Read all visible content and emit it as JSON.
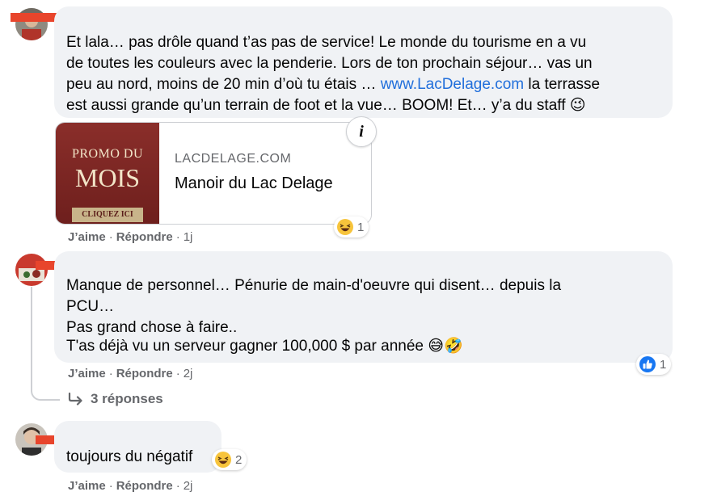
{
  "comments": [
    {
      "lines": [
        "Et lala… pas drôle quand t’as pas de service! Le monde du tourisme en a vu",
        "de toutes les couleurs avec la penderie. Lors de ton prochain séjour… vas un",
        "peu au nord, moins de 20 min d’où tu étais … "
      ],
      "link_text": "www.LacDelage.com",
      "line3_after_link": " la terrasse",
      "line4": "est aussi grande qu’un terrain de foot et la vue… BOOM! Et… y’a du staff 😉",
      "card": {
        "image_line1": "PROMO DU",
        "image_line2": "MOIS",
        "image_ribbon": "CLIQUEZ ICI",
        "domain": "LACDELAGE.COM",
        "title": "Manoir du Lac Delage",
        "info_icon": "i"
      },
      "reaction": {
        "icon": "laughing-emoji-icon",
        "count": "1"
      },
      "actions": {
        "like": "J’aime",
        "reply": "Répondre",
        "time": "1j",
        "separator": "·"
      }
    },
    {
      "lines": [
        "Manque de personnel… Pénurie de main-d'oeuvre qui disent… depuis la",
        "PCU…",
        "Pas grand chose à faire..",
        "T'as déjà vu un serveur gagner 100,000 $ par année 😅🤣"
      ],
      "reaction": {
        "icon": "like-thumb-icon",
        "count": "1"
      },
      "actions": {
        "like": "J’aime",
        "reply": "Répondre",
        "time": "2j",
        "separator": "·"
      },
      "replies_label": "3 réponses"
    },
    {
      "lines": [
        "toujours du négatif"
      ],
      "reaction": {
        "icon": "laughing-emoji-icon",
        "count": "2"
      },
      "actions": {
        "like": "J’aime",
        "reply": "Répondre",
        "time": "2j",
        "separator": "·"
      }
    }
  ],
  "colors": {
    "bubble": "#f0f2f5",
    "link": "#216fdb",
    "redaction": "#e8452c",
    "meta": "#65676b"
  }
}
